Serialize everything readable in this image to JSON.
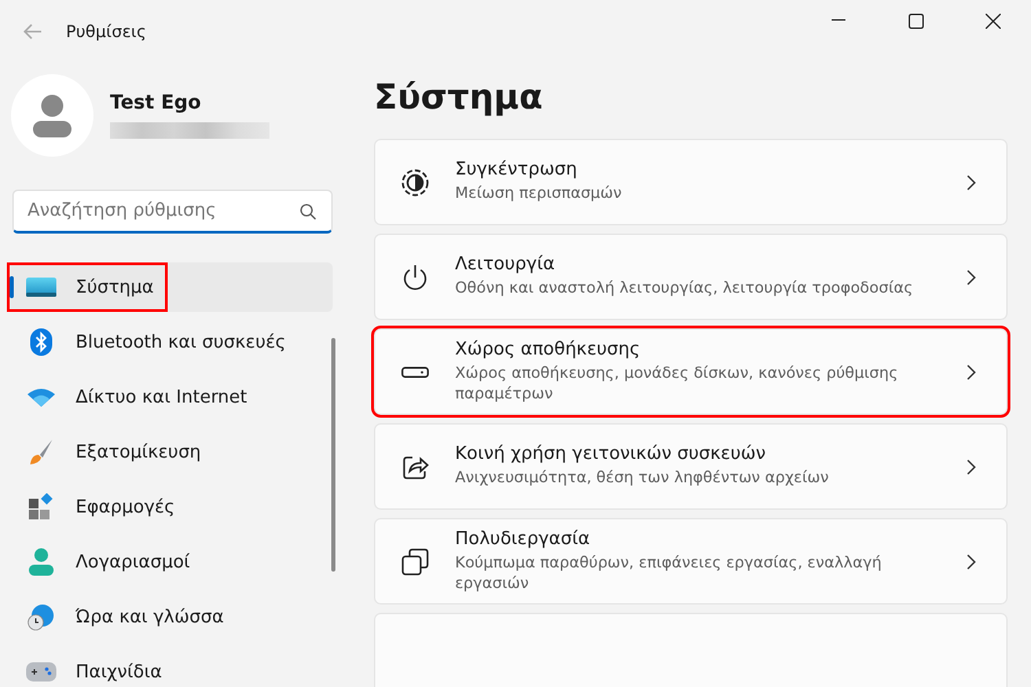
{
  "window": {
    "title": "Ρυθμίσεις"
  },
  "profile": {
    "name": "Test Ego"
  },
  "search": {
    "placeholder": "Αναζήτηση ρύθμισης"
  },
  "nav": [
    {
      "label": "Σύστημα",
      "selected": true,
      "highlighted": true
    },
    {
      "label": "Bluetooth και συσκευές",
      "selected": false,
      "highlighted": false
    },
    {
      "label": "Δίκτυο και Internet",
      "selected": false,
      "highlighted": false
    },
    {
      "label": "Εξατομίκευση",
      "selected": false,
      "highlighted": false
    },
    {
      "label": "Εφαρμογές",
      "selected": false,
      "highlighted": false
    },
    {
      "label": "Λογαριασμοί",
      "selected": false,
      "highlighted": false
    },
    {
      "label": "Ώρα και γλώσσα",
      "selected": false,
      "highlighted": false
    },
    {
      "label": "Παιχνίδια",
      "selected": false,
      "highlighted": false
    }
  ],
  "page_title": "Σύστημα",
  "cards": [
    {
      "title": "Συγκέντρωση",
      "description": "Μείωση περισπασμών",
      "highlighted": false
    },
    {
      "title": "Λειτουργία",
      "description": "Οθόνη και αναστολή λειτουργίας, λειτουργία τροφοδοσίας",
      "highlighted": false
    },
    {
      "title": "Χώρος αποθήκευσης",
      "description": "Χώρος αποθήκευσης, μονάδες δίσκων, κανόνες ρύθμισης παραμέτρων",
      "highlighted": true
    },
    {
      "title": "Κοινή χρήση γειτονικών συσκευών",
      "description": "Ανιχνευσιμότητα, θέση των ληφθέντων αρχείων",
      "highlighted": false
    },
    {
      "title": "Πολυδιεργασία",
      "description": "Κούμπωμα παραθύρων, επιφάνειες εργασίας, εναλλαγή εργασιών",
      "highlighted": false
    }
  ]
}
